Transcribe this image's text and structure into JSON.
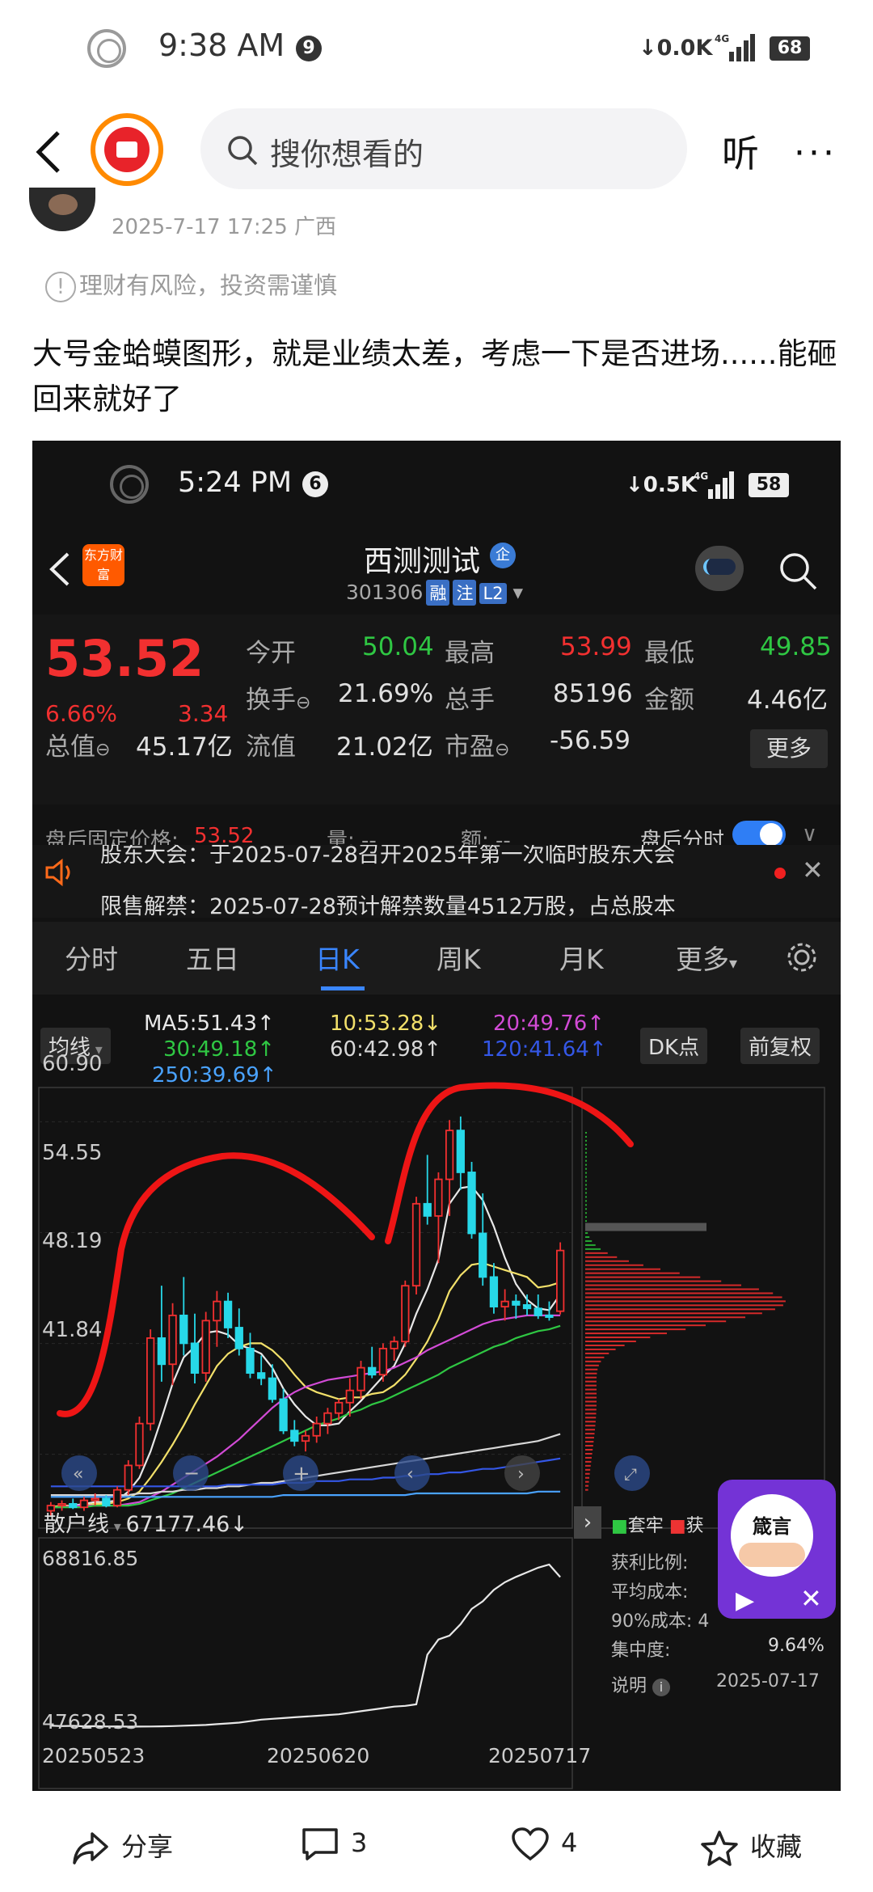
{
  "status_bar": {
    "time": "9:38 AM",
    "notif_count": "9",
    "net_speed": "0.0K",
    "signal": "4G",
    "battery": "68"
  },
  "nav": {
    "search_placeholder": "搜你想看的",
    "listen": "听",
    "more": "···"
  },
  "post": {
    "meta": "2025-7-17 17:25 广西",
    "risk": "理财有风险，投资需谨慎",
    "text": "大号金蛤蟆图形，就是业绩太差，考虑一下是否进场......能砸回来就好了"
  },
  "shot": {
    "status": {
      "time": "5:24 PM",
      "notif_count": "6",
      "net_speed": "0.5K",
      "battery": "58"
    },
    "logo_text": "东方财富",
    "stock_name": "西测测试",
    "stock_tag": "企",
    "stock_code": "301306",
    "code_tags": [
      "融",
      "注",
      "L2"
    ],
    "quote": {
      "price": "53.52",
      "change_pct": "6.66%",
      "change_val": "3.34",
      "fields": [
        {
          "label": "今开",
          "value": "50.04"
        },
        {
          "label": "最高",
          "value": "53.99"
        },
        {
          "label": "最低",
          "value": "49.85"
        },
        {
          "label": "换手",
          "value": "21.69%"
        },
        {
          "label": "总手",
          "value": "85196"
        },
        {
          "label": "金额",
          "value": "4.46亿"
        },
        {
          "label": "总值",
          "value": "45.17亿"
        },
        {
          "label": "流值",
          "value": "21.02亿"
        },
        {
          "label": "市盈",
          "value": "-56.59"
        }
      ],
      "more": "更多"
    },
    "after_hours": {
      "label": "盘后固定价格:",
      "price": "53.52",
      "vol": "量: --",
      "amt": "额: --",
      "switch_label": "盘后分时"
    },
    "notices": [
      "股东大会：于2025-07-28召开2025年第一次临时股东大会",
      "限售解禁：2025-07-28预计解禁数量4512万股，占总股本"
    ],
    "tabs": [
      "分时",
      "五日",
      "日K",
      "周K",
      "月K",
      "更多"
    ],
    "active_tab": "日K",
    "ma": {
      "btn": "均线",
      "ma5": "MA5:51.43↑",
      "ma10": "10:53.28↓",
      "ma20": "20:49.76↑",
      "ma30": "30:49.18↑",
      "ma60": "60:42.98↑",
      "ma120": "120:41.64↑",
      "ma250": "250:39.69↑",
      "dk": "DK点",
      "fq": "前复权"
    },
    "retail": {
      "label": "散户线",
      "value": "67177.46↓",
      "y_top": "68816.85",
      "y_bottom": "47628.53",
      "dates": [
        "20250523",
        "20250620",
        "20250717"
      ]
    },
    "chip": {
      "legend_profit": "获",
      "legend_trapped": "套牢",
      "rows": [
        {
          "label": "获利比例:",
          "value": ""
        },
        {
          "label": "平均成本:",
          "value": ""
        },
        {
          "label": "90%成本:",
          "value": "4"
        },
        {
          "label": "集中度:",
          "value": "9.64%"
        }
      ],
      "note": "说明",
      "date": "2025-07-17"
    },
    "promo": {
      "text": "箴言"
    }
  },
  "chart_data": {
    "type": "candlestick",
    "ylabel_ticks": [
      "60.90",
      "54.55",
      "48.19",
      "41.84"
    ],
    "yticks": [
      60.9,
      54.55,
      48.19,
      41.84
    ],
    "ylim": [
      38.3,
      62.4
    ],
    "candles": [
      [
        38.6,
        39.1,
        38.3,
        38.9
      ],
      [
        38.9,
        39.2,
        38.6,
        39.0
      ],
      [
        39.0,
        39.3,
        38.7,
        38.8
      ],
      [
        38.8,
        39.4,
        38.6,
        39.2
      ],
      [
        39.2,
        39.6,
        38.9,
        39.3
      ],
      [
        39.3,
        39.5,
        38.8,
        38.9
      ],
      [
        38.9,
        40.0,
        38.8,
        39.8
      ],
      [
        39.8,
        41.5,
        39.5,
        41.2
      ],
      [
        41.2,
        44.0,
        41.0,
        43.6
      ],
      [
        43.6,
        49.0,
        43.2,
        48.5
      ],
      [
        48.5,
        51.5,
        46.0,
        47.0
      ],
      [
        47.0,
        50.5,
        45.8,
        49.8
      ],
      [
        49.8,
        52.0,
        47.5,
        48.2
      ],
      [
        48.2,
        49.9,
        45.9,
        46.5
      ],
      [
        46.5,
        50.0,
        46.0,
        49.5
      ],
      [
        49.5,
        51.2,
        48.0,
        50.6
      ],
      [
        50.6,
        51.1,
        48.5,
        49.1
      ],
      [
        49.1,
        50.2,
        47.5,
        47.9
      ],
      [
        47.9,
        48.8,
        46.2,
        46.5
      ],
      [
        46.5,
        47.5,
        45.8,
        46.2
      ],
      [
        46.2,
        47.0,
        44.8,
        45.0
      ],
      [
        45.0,
        45.6,
        43.0,
        43.2
      ],
      [
        43.2,
        43.8,
        42.3,
        42.6
      ],
      [
        42.6,
        43.2,
        42.0,
        42.9
      ],
      [
        42.9,
        44.0,
        42.5,
        43.6
      ],
      [
        43.6,
        44.5,
        43.0,
        44.2
      ],
      [
        44.2,
        45.0,
        43.8,
        44.8
      ],
      [
        44.8,
        46.2,
        44.0,
        45.5
      ],
      [
        45.5,
        47.2,
        45.0,
        46.8
      ],
      [
        46.8,
        48.0,
        46.2,
        46.4
      ],
      [
        46.4,
        48.2,
        46.0,
        47.9
      ],
      [
        47.9,
        48.6,
        47.2,
        48.3
      ],
      [
        48.3,
        51.8,
        48.0,
        51.5
      ],
      [
        51.5,
        56.6,
        51.0,
        56.2
      ],
      [
        56.2,
        59.0,
        55.0,
        55.5
      ],
      [
        55.5,
        58.0,
        52.8,
        57.6
      ],
      [
        57.6,
        61.0,
        55.5,
        60.4
      ],
      [
        60.4,
        61.2,
        57.0,
        58.0
      ],
      [
        58.0,
        58.6,
        54.2,
        54.5
      ],
      [
        54.5,
        56.8,
        51.5,
        52.0
      ],
      [
        52.0,
        52.8,
        49.9,
        50.3
      ],
      [
        50.3,
        51.3,
        49.5,
        50.6
      ],
      [
        50.6,
        51.0,
        49.6,
        50.4
      ],
      [
        50.4,
        51.0,
        49.8,
        50.2
      ],
      [
        50.2,
        51.0,
        49.6,
        49.8
      ],
      [
        49.8,
        50.6,
        49.5,
        49.7
      ],
      [
        50.04,
        53.99,
        49.85,
        53.52
      ]
    ],
    "ma_lines": [
      {
        "name": "MA5",
        "color": "#e8e8e8",
        "values": [
          38.8,
          38.9,
          38.9,
          39.0,
          39.1,
          39.1,
          39.2,
          39.7,
          40.5,
          42.0,
          43.9,
          45.9,
          47.4,
          48.0,
          48.8,
          48.9,
          48.7,
          48.1,
          47.9,
          47.6,
          46.8,
          45.6,
          44.7,
          44.0,
          43.5,
          43.5,
          43.6,
          44.3,
          44.9,
          45.6,
          46.3,
          46.9,
          48.2,
          49.9,
          51.3,
          53.0,
          56.2,
          57.1,
          57.2,
          56.4,
          54.9,
          53.1,
          51.6,
          50.7,
          50.2,
          50.1,
          51.0
        ]
      },
      {
        "name": "MA10",
        "color": "#f2e06a",
        "values": [
          38.8,
          38.9,
          38.9,
          38.9,
          39.0,
          39.0,
          39.1,
          39.3,
          39.7,
          40.5,
          41.4,
          42.4,
          43.5,
          44.7,
          45.8,
          46.9,
          47.6,
          48.0,
          48.2,
          48.2,
          47.8,
          47.2,
          46.4,
          45.7,
          45.4,
          45.2,
          45.0,
          45.1,
          45.1,
          45.3,
          45.4,
          45.8,
          46.4,
          47.3,
          48.3,
          49.6,
          51.2,
          52.1,
          52.7,
          52.8,
          52.6,
          52.4,
          52.2,
          52.0,
          51.4,
          51.5,
          51.7
        ]
      },
      {
        "name": "MA20",
        "color": "#d24bd6",
        "values": [
          38.8,
          38.8,
          38.9,
          38.9,
          38.9,
          38.9,
          38.9,
          39.0,
          39.1,
          39.4,
          39.7,
          40.1,
          40.5,
          40.9,
          41.3,
          41.7,
          42.2,
          42.7,
          43.3,
          43.9,
          44.5,
          45.0,
          45.4,
          45.7,
          45.9,
          46.1,
          46.2,
          46.3,
          46.4,
          46.5,
          46.6,
          46.8,
          47.1,
          47.4,
          47.8,
          48.1,
          48.4,
          48.7,
          49.0,
          49.3,
          49.5,
          49.6,
          49.7,
          49.8,
          49.8,
          49.8,
          49.8
        ]
      },
      {
        "name": "MA30",
        "color": "#2fc743",
        "values": [
          38.8,
          38.8,
          38.8,
          38.8,
          38.9,
          38.9,
          38.9,
          38.9,
          39.0,
          39.2,
          39.4,
          39.6,
          39.9,
          40.2,
          40.5,
          40.8,
          41.1,
          41.4,
          41.7,
          42.0,
          42.3,
          42.6,
          42.9,
          43.2,
          43.5,
          43.7,
          43.9,
          44.2,
          44.4,
          44.7,
          44.9,
          45.2,
          45.5,
          45.8,
          46.1,
          46.4,
          46.8,
          47.1,
          47.4,
          47.7,
          48.0,
          48.2,
          48.5,
          48.7,
          48.9,
          49.0,
          49.2
        ]
      },
      {
        "name": "MA60",
        "color": "#d8d8d8",
        "values": [
          39.5,
          39.5,
          39.5,
          39.5,
          39.5,
          39.5,
          39.5,
          39.5,
          39.6,
          39.6,
          39.7,
          39.7,
          39.8,
          39.8,
          39.9,
          39.9,
          40.0,
          40.0,
          40.1,
          40.2,
          40.2,
          40.3,
          40.4,
          40.5,
          40.6,
          40.7,
          40.8,
          40.9,
          41.0,
          41.1,
          41.2,
          41.3,
          41.4,
          41.5,
          41.6,
          41.7,
          41.8,
          41.9,
          42.0,
          42.1,
          42.2,
          42.3,
          42.4,
          42.5,
          42.6,
          42.8,
          43.0
        ]
      },
      {
        "name": "MA120",
        "color": "#3457e6",
        "values": [
          40.0,
          40.0,
          40.0,
          40.0,
          40.0,
          40.0,
          40.0,
          40.0,
          40.0,
          40.0,
          40.0,
          40.0,
          40.0,
          40.0,
          40.0,
          40.0,
          40.1,
          40.1,
          40.1,
          40.1,
          40.1,
          40.2,
          40.2,
          40.2,
          40.3,
          40.3,
          40.3,
          40.4,
          40.4,
          40.4,
          40.5,
          40.5,
          40.6,
          40.6,
          40.7,
          40.7,
          40.8,
          40.8,
          40.9,
          41.0,
          41.0,
          41.1,
          41.2,
          41.3,
          41.4,
          41.5,
          41.6
        ]
      },
      {
        "name": "MA250",
        "color": "#4aa3ff",
        "values": [
          39.4,
          39.4,
          39.4,
          39.4,
          39.4,
          39.4,
          39.4,
          39.4,
          39.4,
          39.4,
          39.4,
          39.4,
          39.4,
          39.4,
          39.4,
          39.4,
          39.4,
          39.4,
          39.4,
          39.4,
          39.4,
          39.5,
          39.5,
          39.5,
          39.5,
          39.5,
          39.5,
          39.5,
          39.5,
          39.5,
          39.5,
          39.5,
          39.5,
          39.6,
          39.6,
          39.6,
          39.6,
          39.6,
          39.6,
          39.6,
          39.6,
          39.6,
          39.6,
          39.6,
          39.7,
          39.7,
          39.7
        ]
      }
    ],
    "retail_line": [
      47700,
      47650,
      47680,
      47620,
      47640,
      47600,
      47610,
      47580,
      47590,
      47600,
      47620,
      47650,
      47700,
      47750,
      47800,
      47900,
      48000,
      48100,
      48300,
      48500,
      48600,
      48700,
      48800,
      48900,
      49000,
      49100,
      49200,
      49400,
      49600,
      49800,
      50000,
      50200,
      50300,
      50500,
      57000,
      59000,
      59500,
      61000,
      63000,
      64000,
      65500,
      66500,
      67200,
      67800,
      68400,
      68816,
      67177
    ],
    "chip_profit_ratio": [
      0.3,
      0.5,
      0.7,
      0.9,
      1.0
    ],
    "chip_trapped_ratio": [
      1.0,
      0.85,
      0.6,
      0.4,
      0.2
    ]
  }
}
